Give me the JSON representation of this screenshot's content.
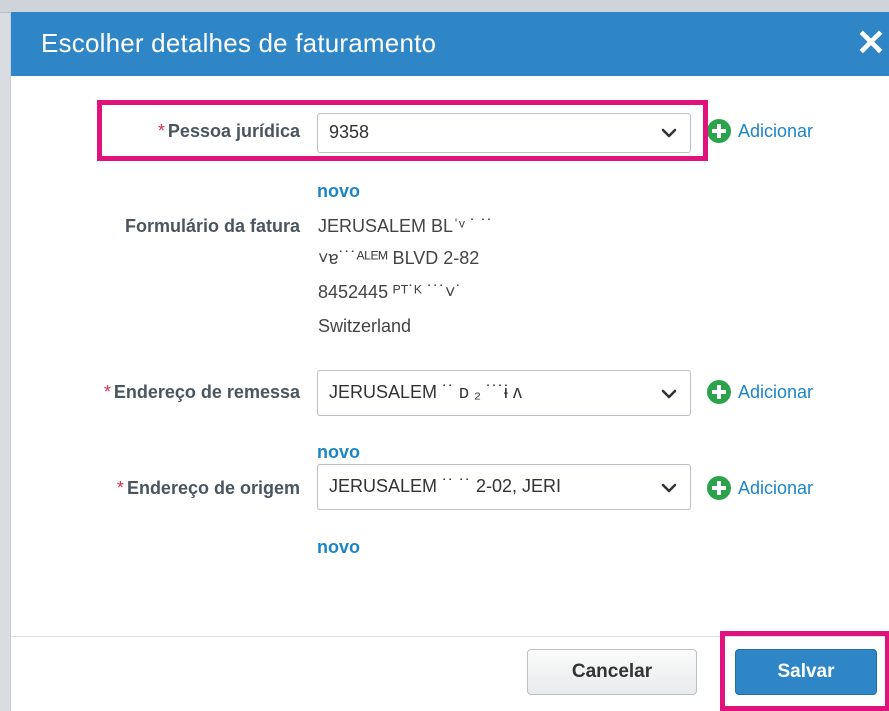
{
  "dialog": {
    "title": "Escolher detalhes de faturamento",
    "close_label": "✕"
  },
  "fields": {
    "legal_entity": {
      "required_mark": "*",
      "label": "Pessoa jurídica",
      "value": "9358",
      "add_label": "Adicionar",
      "add_label_line2": "novo"
    },
    "invoice_form": {
      "label": "Formulário da fatura",
      "lines": [
        "JERUSALEM BLˈᵛ ˙ ˙˙",
        "˅ɐ˙˙˙ᴬᴸᴱᴹ BLVD 2-82",
        "8452445 ᴾᵀ˙ᴷ ˙˙˙˅˙",
        "Switzerland"
      ]
    },
    "ship_to": {
      "required_mark": "*",
      "label": "Endereço de remessa",
      "value": "JERUSALEM ˙˙ ᴅ ₂       ˙˙˙ɨ ʌ",
      "add_label": "Adicionar",
      "add_label_line2": "novo"
    },
    "ship_from": {
      "required_mark": "*",
      "label": "Endereço de origem",
      "value": "JERUSALEM ˙˙ ˙˙ 2-02, JERI",
      "add_label": "Adicionar",
      "add_label_line2": "novo"
    }
  },
  "footer": {
    "cancel_label": "Cancelar",
    "save_label": "Salvar"
  },
  "colors": {
    "titlebar": "#2f86c6",
    "link": "#1b85c7",
    "add_icon": "#2aa34a",
    "required": "#d6334a",
    "highlight": "#e0137e"
  }
}
